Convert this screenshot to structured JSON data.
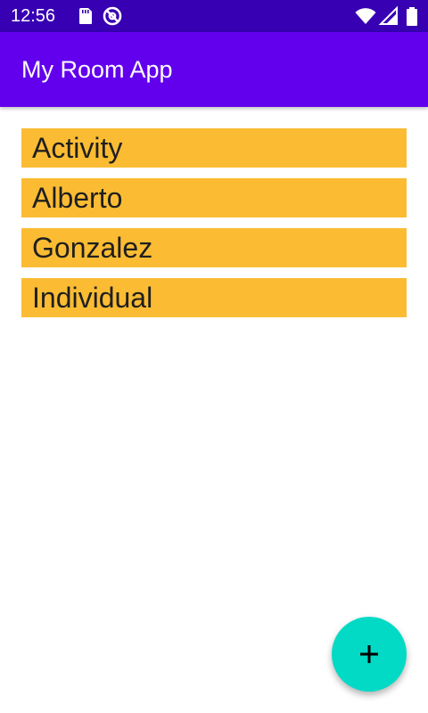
{
  "status_bar": {
    "time": "12:56",
    "left_icons": [
      "sd-card-icon",
      "do-not-disturb-icon"
    ],
    "right_icons": [
      "wifi-icon",
      "cell-signal-icon",
      "battery-icon"
    ],
    "background": "#3700b3"
  },
  "app_bar": {
    "title": "My Room App",
    "background": "#6200ee"
  },
  "word_list": {
    "item_color": "#fbbc33",
    "items": [
      {
        "label": "Activity"
      },
      {
        "label": "Alberto"
      },
      {
        "label": "Gonzalez"
      },
      {
        "label": "Individual"
      }
    ]
  },
  "fab": {
    "icon": "plus-icon",
    "background": "#03dac5"
  }
}
